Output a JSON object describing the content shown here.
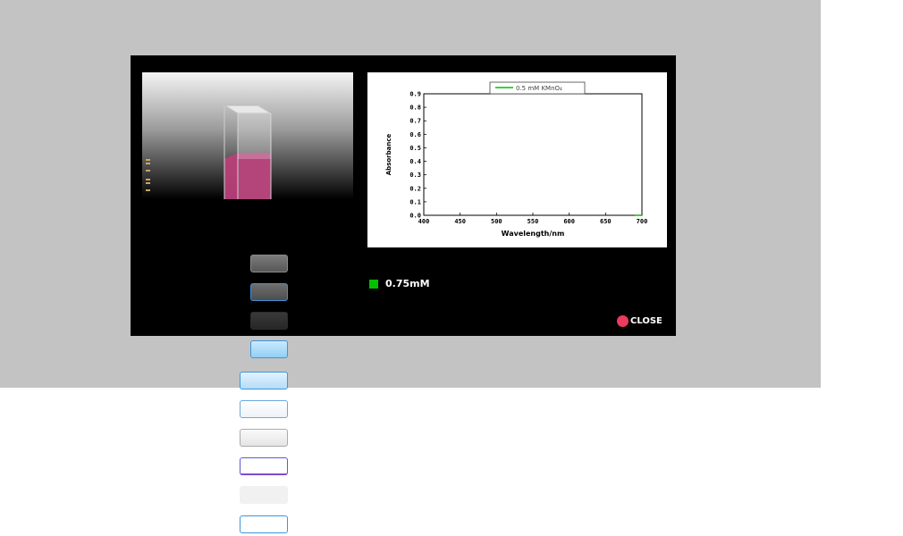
{
  "colors": {
    "background_gray": "#c3c3c3",
    "panel": "#000000",
    "solution": "#b8407a",
    "series": "#00c000",
    "close_dot": "#ee3a5e"
  },
  "legend": {
    "label": "0.75mM",
    "color": "#00c000"
  },
  "close": {
    "label": "CLOSE",
    "icon": "red-dot-icon"
  },
  "cuvette": {
    "fill_fraction": 0.5
  },
  "chart_data": {
    "type": "line",
    "legend_label": "0.5 mM KMnO₄",
    "xlabel": "Wavelength/nm",
    "ylabel": "Absorbance",
    "xlim": [
      400,
      700
    ],
    "ylim": [
      0,
      0.9
    ],
    "x_ticks": [
      "400",
      "450",
      "500",
      "550",
      "600",
      "650",
      "700"
    ],
    "y_ticks": [
      "0.0",
      "0.1",
      "0.2",
      "0.3",
      "0.4",
      "0.5",
      "0.6",
      "0.7",
      "0.8",
      "0.9"
    ],
    "series": [
      {
        "name": "0.5 mM KMnO₄",
        "color": "#00c000",
        "x": [
          690,
          700
        ],
        "y": [
          0.0,
          0.0
        ]
      }
    ]
  }
}
